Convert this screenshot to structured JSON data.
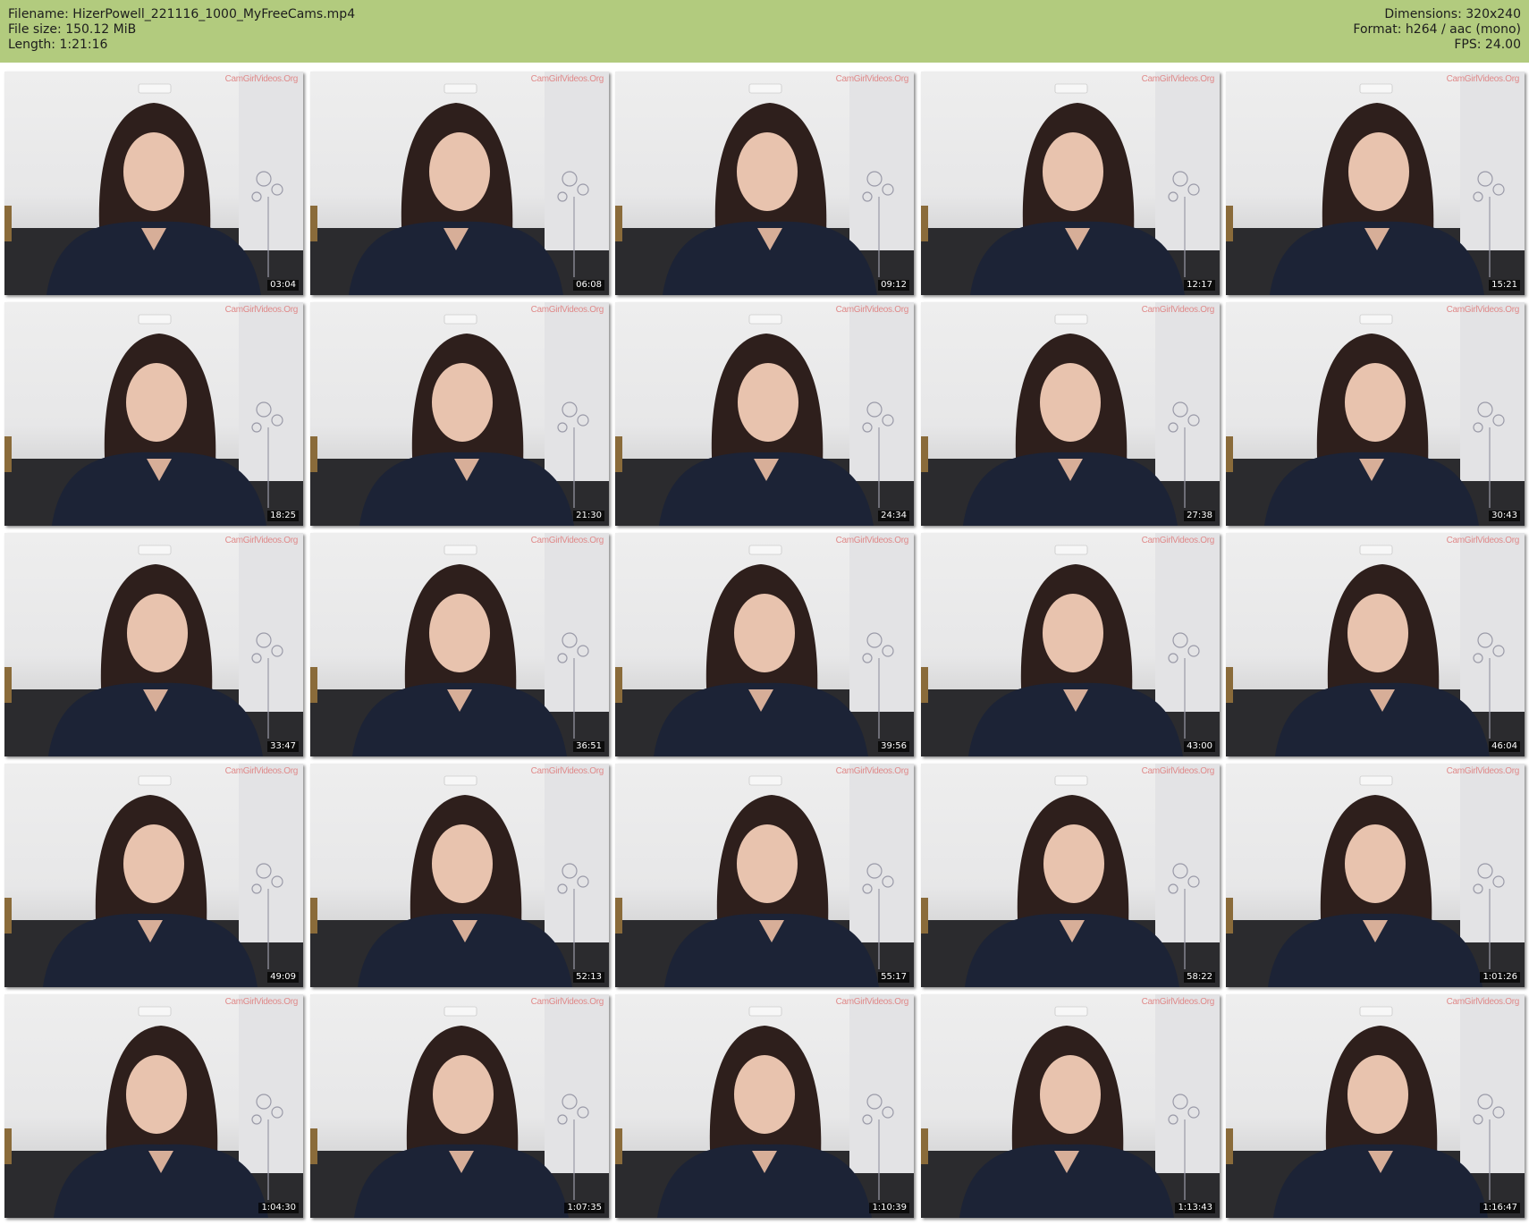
{
  "header": {
    "filename_line": "Filename: HizerPowell_221116_1000_MyFreeCams.mp4",
    "filesize_line": "File size: 150.12 MiB",
    "length_line": "Length: 1:21:16",
    "dimensions_line": "Dimensions: 320x240",
    "format_line": "Format: h264 / aac (mono)",
    "fps_line": "FPS: 24.00"
  },
  "colors": {
    "header_background": "#b2cb7e",
    "watermark": "#e08a8a",
    "timestamp_background": "#000000"
  },
  "thumbnails": [
    {
      "timestamp": "03:04",
      "watermark": "CamGirlVideos.Org"
    },
    {
      "timestamp": "06:08",
      "watermark": "CamGirlVideos.Org"
    },
    {
      "timestamp": "09:12",
      "watermark": "CamGirlVideos.Org"
    },
    {
      "timestamp": "12:17",
      "watermark": "CamGirlVideos.Org"
    },
    {
      "timestamp": "15:21",
      "watermark": "CamGirlVideos.Org"
    },
    {
      "timestamp": "18:25",
      "watermark": "CamGirlVideos.Org"
    },
    {
      "timestamp": "21:30",
      "watermark": "CamGirlVideos.Org"
    },
    {
      "timestamp": "24:34",
      "watermark": "CamGirlVideos.Org"
    },
    {
      "timestamp": "27:38",
      "watermark": "CamGirlVideos.Org"
    },
    {
      "timestamp": "30:43",
      "watermark": "CamGirlVideos.Org"
    },
    {
      "timestamp": "33:47",
      "watermark": "CamGirlVideos.Org"
    },
    {
      "timestamp": "36:51",
      "watermark": "CamGirlVideos.Org"
    },
    {
      "timestamp": "39:56",
      "watermark": "CamGirlVideos.Org"
    },
    {
      "timestamp": "43:00",
      "watermark": "CamGirlVideos.Org"
    },
    {
      "timestamp": "46:04",
      "watermark": "CamGirlVideos.Org"
    },
    {
      "timestamp": "49:09",
      "watermark": "CamGirlVideos.Org"
    },
    {
      "timestamp": "52:13",
      "watermark": "CamGirlVideos.Org"
    },
    {
      "timestamp": "55:17",
      "watermark": "CamGirlVideos.Org"
    },
    {
      "timestamp": "58:22",
      "watermark": "CamGirlVideos.Org"
    },
    {
      "timestamp": "1:01:26",
      "watermark": "CamGirlVideos.Org"
    },
    {
      "timestamp": "1:04:30",
      "watermark": "CamGirlVideos.Org"
    },
    {
      "timestamp": "1:07:35",
      "watermark": "CamGirlVideos.Org"
    },
    {
      "timestamp": "1:10:39",
      "watermark": "CamGirlVideos.Org"
    },
    {
      "timestamp": "1:13:43",
      "watermark": "CamGirlVideos.Org"
    },
    {
      "timestamp": "1:16:47",
      "watermark": "CamGirlVideos.Org"
    }
  ]
}
